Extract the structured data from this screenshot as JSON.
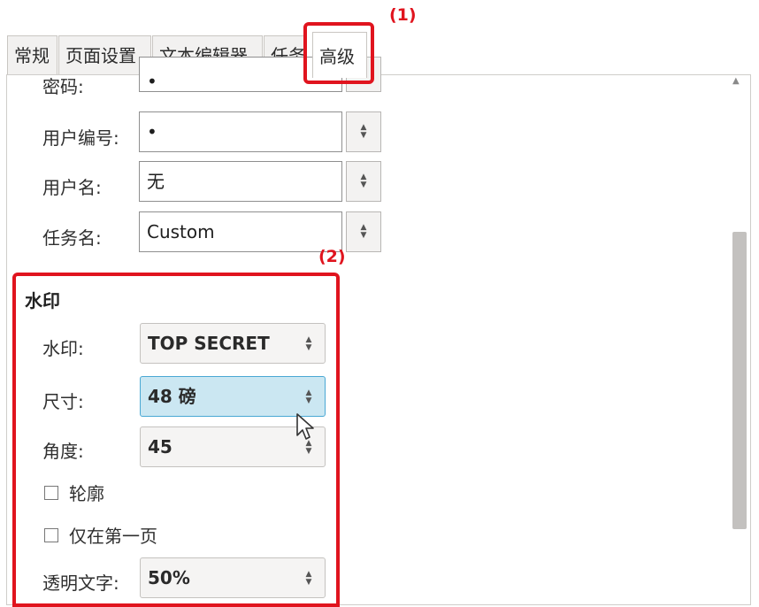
{
  "tabs": [
    {
      "label": "常规"
    },
    {
      "label": "页面设置"
    },
    {
      "label": "文本编辑器"
    },
    {
      "label": "任务"
    },
    {
      "label": "高级"
    }
  ],
  "fields": {
    "password": {
      "label": "密码:",
      "value": "•"
    },
    "user_number": {
      "label": "用户编号:",
      "value": "•"
    },
    "user_name": {
      "label": "用户名:",
      "value": "无"
    },
    "job_name": {
      "label": "任务名:",
      "value": "Custom"
    }
  },
  "watermark": {
    "section_title": "水印",
    "watermark": {
      "label": "水印:",
      "value": "TOP SECRET"
    },
    "size": {
      "label": "尺寸:",
      "value": "48 磅"
    },
    "angle": {
      "label": "角度:",
      "value": "45"
    },
    "outline": {
      "label": "轮廓",
      "checked": false
    },
    "first_page_only": {
      "label": "仅在第一页",
      "checked": false
    },
    "transparent_text": {
      "label": "透明文字:",
      "value": "50%"
    }
  },
  "callouts": {
    "one": "(1)",
    "two": "(2)"
  },
  "colors": {
    "callout": "#e0141e",
    "hover_field": "#cbe7f2"
  }
}
